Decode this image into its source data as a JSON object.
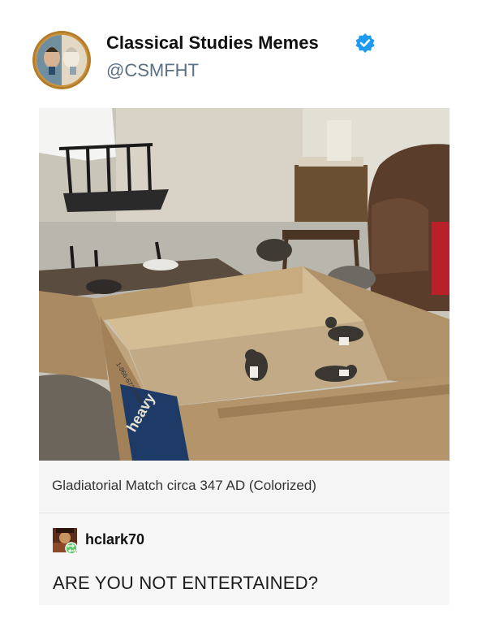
{
  "profile": {
    "display_name": "Classical Studies Memes",
    "handle": "@CSMFHT",
    "verified": true,
    "avatar_icon": "two-faces-avatar-icon",
    "verified_icon": "verified-badge-icon",
    "verified_color": "#1d9bf0"
  },
  "post": {
    "image_icon": "kittens-in-cardboard-box-photo",
    "caption": "Gladiatorial Match circa 347 AD (Colorized)"
  },
  "reply": {
    "username": "hclark70",
    "avatar_icon": "user-avatar-icon",
    "reblog_icon": "reblog-icon",
    "reblog_color": "#5bc96a",
    "text": "ARE YOU NOT ENTERTAINED?"
  }
}
